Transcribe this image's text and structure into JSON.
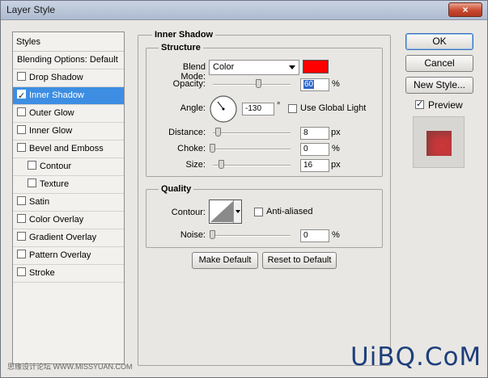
{
  "window": {
    "title": "Layer Style",
    "close_symbol": "×"
  },
  "styles_panel": {
    "header": "Styles",
    "items": [
      {
        "label": "Blending Options: Default",
        "checkbox": false,
        "checked": false,
        "sub": false,
        "active": false
      },
      {
        "label": "Drop Shadow",
        "checkbox": true,
        "checked": false,
        "sub": false,
        "active": false
      },
      {
        "label": "Inner Shadow",
        "checkbox": true,
        "checked": true,
        "sub": false,
        "active": true
      },
      {
        "label": "Outer Glow",
        "checkbox": true,
        "checked": false,
        "sub": false,
        "active": false
      },
      {
        "label": "Inner Glow",
        "checkbox": true,
        "checked": false,
        "sub": false,
        "active": false
      },
      {
        "label": "Bevel and Emboss",
        "checkbox": true,
        "checked": false,
        "sub": false,
        "active": false
      },
      {
        "label": "Contour",
        "checkbox": true,
        "checked": false,
        "sub": true,
        "active": false
      },
      {
        "label": "Texture",
        "checkbox": true,
        "checked": false,
        "sub": true,
        "active": false
      },
      {
        "label": "Satin",
        "checkbox": true,
        "checked": false,
        "sub": false,
        "active": false
      },
      {
        "label": "Color Overlay",
        "checkbox": true,
        "checked": false,
        "sub": false,
        "active": false
      },
      {
        "label": "Gradient Overlay",
        "checkbox": true,
        "checked": false,
        "sub": false,
        "active": false
      },
      {
        "label": "Pattern Overlay",
        "checkbox": true,
        "checked": false,
        "sub": false,
        "active": false
      },
      {
        "label": "Stroke",
        "checkbox": true,
        "checked": false,
        "sub": false,
        "active": false
      }
    ]
  },
  "inner_shadow": {
    "section_title": "Inner Shadow",
    "structure_title": "Structure",
    "blend_mode_label": "Blend Mode:",
    "blend_mode_value": "Color",
    "blend_color": "#ff0000",
    "opacity_label": "Opacity:",
    "opacity_value": "60",
    "opacity_unit": "%",
    "opacity_level": 0.6,
    "angle_label": "Angle:",
    "angle_value": "-130",
    "angle_unit": "°",
    "use_global_light_label": "Use Global Light",
    "use_global_light_checked": false,
    "distance_label": "Distance:",
    "distance_value": "8",
    "distance_unit": "px",
    "distance_level": 0.03,
    "choke_label": "Choke:",
    "choke_value": "0",
    "choke_unit": "%",
    "choke_level": 0.0,
    "size_label": "Size:",
    "size_value": "16",
    "size_unit": "px",
    "size_level": 0.07,
    "quality_title": "Quality",
    "contour_label": "Contour:",
    "anti_aliased_label": "Anti-aliased",
    "anti_aliased_checked": false,
    "noise_label": "Noise:",
    "noise_value": "0",
    "noise_unit": "%",
    "noise_level": 0.0
  },
  "buttons": {
    "make_default": "Make Default",
    "reset_to_default": "Reset to Default",
    "ok": "OK",
    "cancel": "Cancel",
    "new_style": "New Style..."
  },
  "preview": {
    "label": "Preview",
    "checked": true,
    "swatch_color": "#c8373a"
  },
  "watermarks": {
    "left": "思缘设计论坛 WWW.MISSYUAN.COM",
    "right": "UiBQ.CoM"
  }
}
